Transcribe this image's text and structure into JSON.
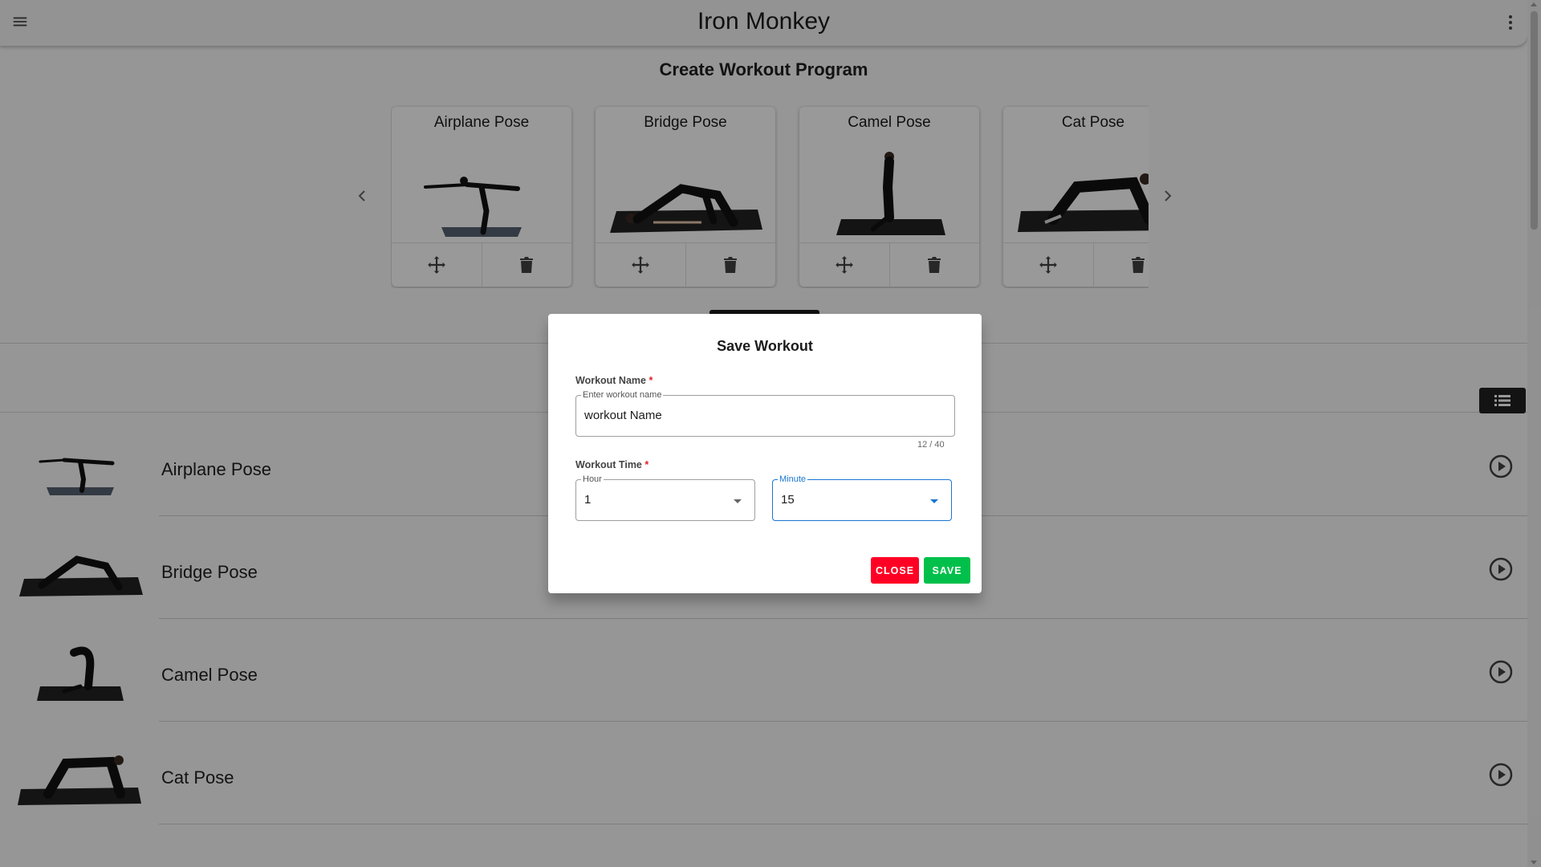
{
  "app": {
    "title": "Iron Monkey"
  },
  "page": {
    "title": "Create Workout Program"
  },
  "carousel": {
    "cards": [
      {
        "title": "Airplane Pose"
      },
      {
        "title": "Bridge Pose"
      },
      {
        "title": "Camel Pose"
      },
      {
        "title": "Cat Pose"
      }
    ]
  },
  "list": {
    "items": [
      {
        "name": "Airplane Pose"
      },
      {
        "name": "Bridge Pose"
      },
      {
        "name": "Camel Pose"
      },
      {
        "name": "Cat Pose"
      }
    ]
  },
  "dialog": {
    "title": "Save Workout",
    "name_label": "Workout Name",
    "name_placeholder": "Enter workout name",
    "name_value": "workout Name",
    "name_counter": "12 / 40",
    "time_label": "Workout Time",
    "hour_label": "Hour",
    "hour_value": "1",
    "minute_label": "Minute",
    "minute_value": "15",
    "required_mark": "*",
    "close_label": "CLOSE",
    "save_label": "SAVE"
  },
  "colors": {
    "close_button": "#ff0025",
    "save_button": "#00c04b",
    "focus": "#1976d2",
    "required": "#e01e2b"
  }
}
